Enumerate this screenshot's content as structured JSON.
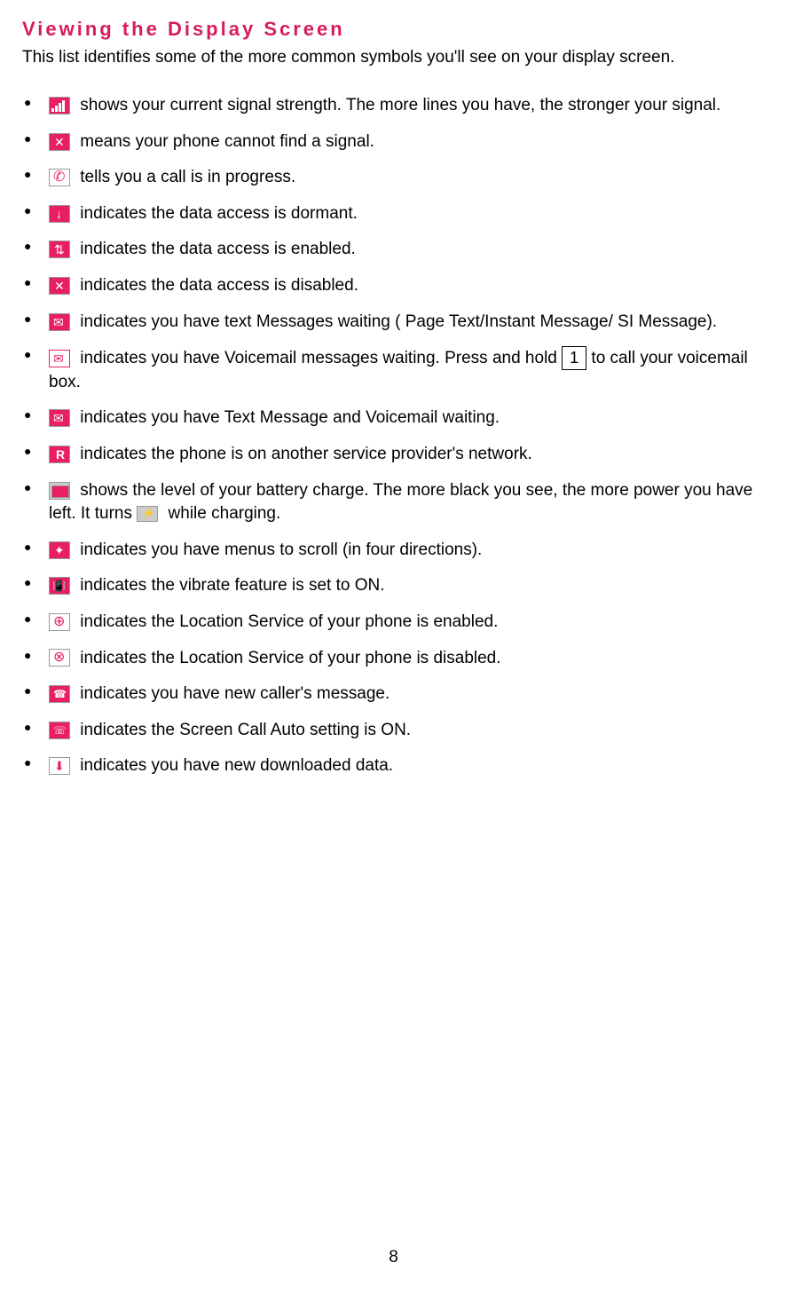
{
  "title": "Viewing the Display Screen",
  "intro": "This list identifies some of the more common symbols you'll see on your display screen.",
  "items": [
    {
      "icon_name": "signal-strength-icon",
      "text_before": "",
      "text_after": " shows your current signal strength. The more lines you have, the stronger your signal."
    },
    {
      "icon_name": "no-signal-icon",
      "text_after": " means your phone cannot find a signal."
    },
    {
      "icon_name": "call-progress-icon",
      "text_after": " tells you a call is in progress."
    },
    {
      "icon_name": "data-dormant-icon",
      "text_after": " indicates the data access is dormant."
    },
    {
      "icon_name": "data-enabled-icon",
      "text_after": " indicates the data access is enabled."
    },
    {
      "icon_name": "data-disabled-icon",
      "text_after": " indicates the data access is disabled."
    },
    {
      "icon_name": "text-messages-icon",
      "text_after": " indicates you have text Messages waiting ( Page Text/Instant Message/ SI Message)."
    },
    {
      "icon_name": "voicemail-icon",
      "text_part1": " indicates you have Voicemail messages waiting. Press and hold ",
      "key": "1",
      "text_part2": " to call your voicemail box."
    },
    {
      "icon_name": "text-voicemail-icon",
      "text_after": " indicates you have Text Message and Voicemail waiting."
    },
    {
      "icon_name": "roaming-icon",
      "text_after": " indicates the phone is on another service provider's network."
    },
    {
      "icon_name": "battery-icon",
      "text_part1": " shows the level of your battery charge. The more black you see, the more power you have left. It turns ",
      "icon2_name": "charging-icon",
      "text_part2": " while charging."
    },
    {
      "icon_name": "scroll-icon",
      "text_after": " indicates you have menus to scroll (in four directions)."
    },
    {
      "icon_name": "vibrate-icon",
      "text_after": " indicates the vibrate feature is set to ON."
    },
    {
      "icon_name": "location-on-icon",
      "text_after": " indicates the Location Service of your phone is enabled."
    },
    {
      "icon_name": "location-off-icon",
      "text_after": " indicates the Location Service of your phone is disabled."
    },
    {
      "icon_name": "caller-message-icon",
      "text_after": " indicates you have new caller's message."
    },
    {
      "icon_name": "screen-call-icon",
      "text_after": " indicates the Screen Call Auto setting is ON."
    },
    {
      "icon_name": "download-icon",
      "text_after": " indicates you have new downloaded data."
    }
  ],
  "page_number": "8"
}
